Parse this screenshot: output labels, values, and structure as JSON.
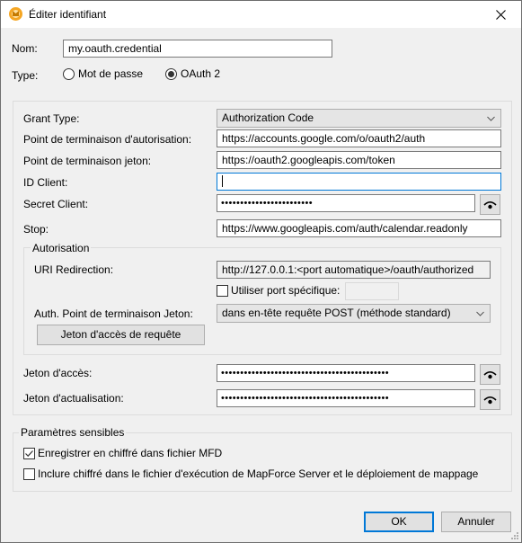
{
  "window": {
    "title": "Éditer identifiant",
    "icon": "mapforce-app-icon",
    "close_icon": "close-icon"
  },
  "name_row": {
    "label": "Nom:",
    "value": "my.oauth.credential"
  },
  "type_row": {
    "label": "Type:",
    "options": [
      {
        "label": "Mot de passe",
        "selected": false
      },
      {
        "label": "OAuth 2",
        "selected": true
      }
    ]
  },
  "oauth": {
    "grant_type": {
      "label": "Grant Type:",
      "value": "Authorization Code"
    },
    "auth_endpoint": {
      "label": "Point de terminaison d'autorisation:",
      "value": "https://accounts.google.com/o/oauth2/auth"
    },
    "token_endpoint": {
      "label": "Point de terminaison jeton:",
      "value": "https://oauth2.googleapis.com/token"
    },
    "client_id": {
      "label": "ID Client:",
      "value": ""
    },
    "client_secret": {
      "label": "Secret Client:",
      "value": "••••••••••••••••••••••••",
      "reveal_icon": "eye-icon"
    },
    "scope": {
      "label": "Stop:",
      "value": "https://www.googleapis.com/auth/calendar.readonly"
    },
    "authorization": {
      "title": "Autorisation",
      "redirect_uri": {
        "label": "URI Redirection:",
        "value": "http://127.0.0.1:<port automatique>/oauth/authorized"
      },
      "specific_port": {
        "label": "Utiliser port spécifique:",
        "checked": false,
        "value": ""
      },
      "token_endpoint_auth": {
        "label": "Auth. Point de terminaison Jeton:",
        "value": "dans en-tête requête POST (méthode standard)"
      },
      "request_button": "Jeton d'accès de requête"
    },
    "access_token": {
      "label": "Jeton d'accès:",
      "value": "••••••••••••••••••••••••••••••••••••••••••••"
    },
    "refresh_token": {
      "label": "Jeton d'actualisation:",
      "value": "••••••••••••••••••••••••••••••••••••••••••••"
    }
  },
  "sensitive": {
    "title": "Paramètres sensibles",
    "options": [
      {
        "label": "Enregistrer en chiffré dans fichier MFD",
        "checked": true
      },
      {
        "label": "Inclure chiffré dans le fichier d'exécution de MapForce Server et le déploiement de mappage",
        "checked": false
      }
    ]
  },
  "footer": {
    "ok": "OK",
    "cancel": "Annuler"
  },
  "colors": {
    "accent": "#0078d7",
    "app_icon": "#f5a623"
  }
}
